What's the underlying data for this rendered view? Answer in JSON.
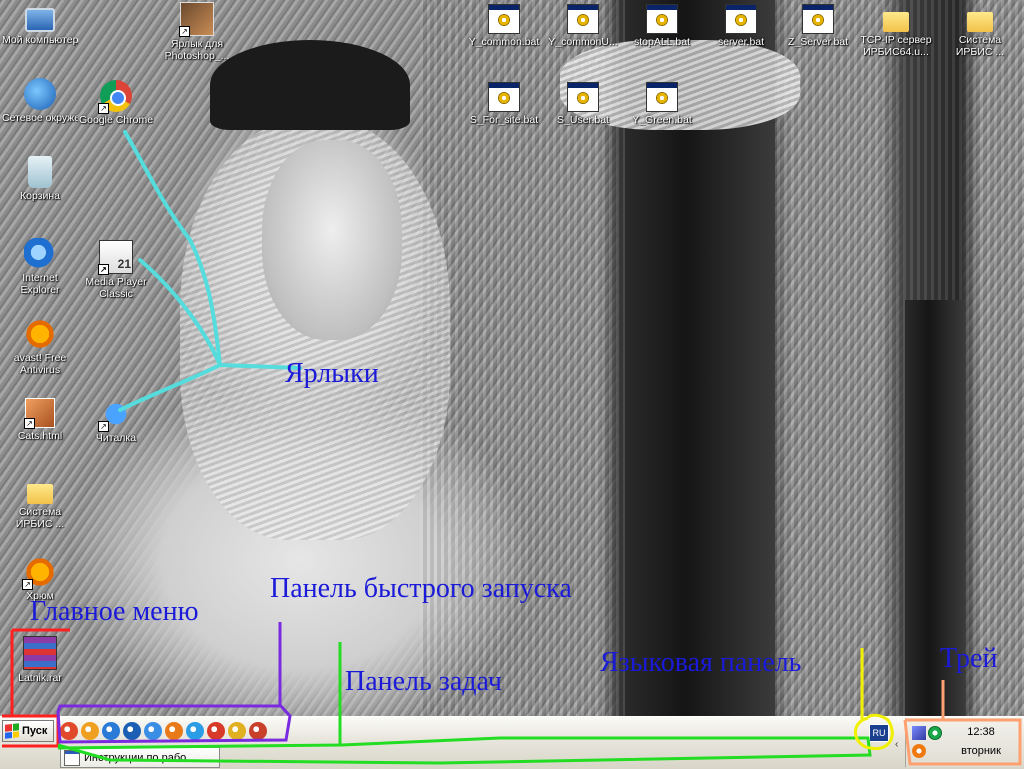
{
  "desktop": {
    "left_column": [
      {
        "label": "Мой компьютер",
        "icon": "my-computer-icon"
      },
      {
        "label": "Сетевое окружение",
        "icon": "network-places-icon"
      },
      {
        "label": "Корзина",
        "icon": "recycle-bin-icon"
      },
      {
        "label": "Internet Explorer",
        "icon": "internet-explorer-icon"
      },
      {
        "label": "avast! Free Antivirus",
        "icon": "avast-icon"
      },
      {
        "label": "Cats.html",
        "icon": "cats-html-icon"
      },
      {
        "label": "Система ИРБИС ...",
        "icon": "folder-icon"
      },
      {
        "label": "Хрюм",
        "icon": "xrum-icon"
      },
      {
        "label": "Latnik.rar",
        "icon": "winrar-archive-icon"
      }
    ],
    "second_column": [
      {
        "label": "Ярлык для Photoshop_...",
        "icon": "photoshop-shortcut-icon"
      },
      {
        "label": "Google Chrome",
        "icon": "chrome-icon"
      },
      {
        "label": "Media Player Classic",
        "icon": "media-player-classic-icon",
        "badge": "21"
      },
      {
        "label": "Читалка",
        "icon": "reader-icon"
      }
    ],
    "top_row": [
      {
        "label": "Y_common.bat",
        "icon": "batch-file-icon"
      },
      {
        "label": "Y_commonU...",
        "icon": "batch-file-icon"
      },
      {
        "label": "stopALL.bat",
        "icon": "batch-file-icon"
      },
      {
        "label": "server.bat",
        "icon": "batch-file-icon"
      },
      {
        "label": "Z_Server.bat",
        "icon": "batch-file-icon"
      },
      {
        "label": "TCP-IP сервер ИРБИС64.u...",
        "icon": "folder-icon"
      },
      {
        "label": "Система ИРБИС ...",
        "icon": "folder-icon"
      }
    ],
    "second_row": [
      {
        "label": "S_For_site.bat",
        "icon": "batch-file-icon"
      },
      {
        "label": "S_User.bat",
        "icon": "batch-file-icon"
      },
      {
        "label": "Y_Green.bat",
        "icon": "batch-file-icon"
      }
    ]
  },
  "annotations": {
    "shortcuts": "Ярлыки",
    "start_menu": "Главное меню",
    "quick_launch": "Панель быстрого запуска",
    "taskbar": "Панель задач",
    "language_bar": "Языковая панель",
    "tray": "Трей"
  },
  "annotation_colors": {
    "shortcuts": "#55dcdc",
    "start_menu": "#ff2020",
    "quick_launch": "#7a2be0",
    "taskbar": "#22dd22",
    "language_bar": "#f0f000",
    "tray": "#ffa070",
    "label_text": "#1a1ad8"
  },
  "taskbar": {
    "start_label": "Пуск",
    "quick_launch": [
      {
        "icon": "chrome-icon",
        "color": "#e04a2a"
      },
      {
        "icon": "pumpkin-icon",
        "color": "#f0a020"
      },
      {
        "icon": "internet-explorer-icon",
        "color": "#2a7ad8"
      },
      {
        "icon": "media-player-icon",
        "color": "#1a5fb4"
      },
      {
        "icon": "notepad-icon",
        "color": "#3a8ee6"
      },
      {
        "icon": "firefox-icon",
        "color": "#e87a1a"
      },
      {
        "icon": "reader-icon",
        "color": "#2a9de6"
      },
      {
        "icon": "game-icon",
        "color": "#d83a2a"
      },
      {
        "icon": "picture-icon",
        "color": "#e0b020"
      },
      {
        "icon": "opera-icon",
        "color": "#c8402a"
      }
    ],
    "task_button": "Инструкции по рабо...",
    "language": "RU",
    "clock_time": "12:38",
    "clock_day": "вторник"
  }
}
